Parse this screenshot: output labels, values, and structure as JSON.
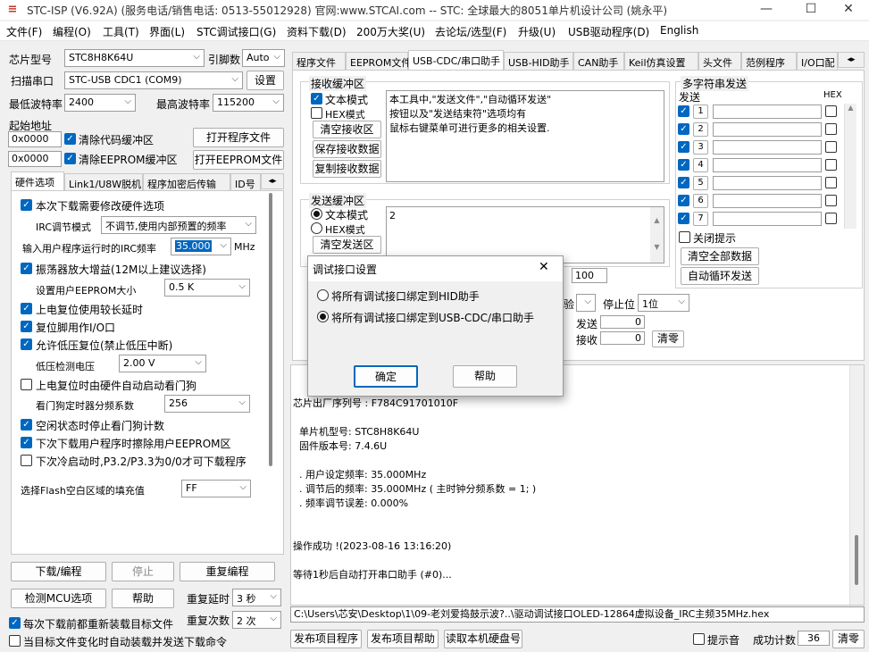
{
  "window": {
    "title": "STC-ISP (V6.92A) (服务电话/销售电话: 0513-55012928) 官网:www.STCAI.com  -- STC: 全球最大的8051单片机设计公司 (姚永平)",
    "min": "—",
    "max": "☐",
    "close": "✕"
  },
  "menu": [
    "文件(F)",
    "编程(O)",
    "工具(T)",
    "界面(L)",
    "STC调试接口(G)",
    "资料下载(D)",
    "200万大奖(U)",
    "去论坛/选型(F)",
    "升级(U)",
    "USB驱动程序(D)",
    "English"
  ],
  "left": {
    "chip_label": "芯片型号",
    "chip_value": "STC8H8K64U",
    "pins_label": "引脚数",
    "pins_value": "Auto",
    "port_btn": "扫描串口",
    "port_value": "STC-USB CDC1 (COM9)",
    "settings_btn": "设置",
    "minbaud_label": "最低波特率",
    "minbaud_value": "2400",
    "maxbaud_label": "最高波特率",
    "maxbaud_value": "115200",
    "start_addr_label": "起始地址",
    "addr1": "0x0000",
    "clear_code_label": "清除代码缓冲区",
    "open_prog_btn": "打开程序文件",
    "addr2": "0x0000",
    "clear_eeprom_label": "清除EEPROM缓冲区",
    "open_eeprom_btn": "打开EEPROM文件",
    "subtabs": [
      "硬件选项",
      "Link1/U8W脱机",
      "程序加密后传输",
      "ID号"
    ],
    "hw": {
      "opt_modify": "本次下载需要修改硬件选项",
      "irc_mode_label": "IRC调节模式",
      "irc_mode_value": "不调节,使用内部预置的频率",
      "irc_freq_label": "输入用户程序运行时的IRC频率",
      "irc_freq_value": "35.000",
      "irc_freq_unit": "MHz",
      "osc_gain": "振荡器放大增益(12M以上建议选择)",
      "eeprom_size_label": "设置用户EEPROM大小",
      "eeprom_size_value": "0.5 K",
      "por_delay": "上电复位使用较长延时",
      "reset_io": "复位脚用作I/O口",
      "lvr": "允许低压复位(禁止低压中断)",
      "lv_label": "低压检测电压",
      "lv_value": "2.00 V",
      "wdt_auto": "上电复位时由硬件自动启动看门狗",
      "wdt_div_label": "看门狗定时器分频系数",
      "wdt_div_value": "256",
      "idle_wdt": "空闲状态时停止看门狗计数",
      "erase_eeprom": "下次下载用户程序时擦除用户EEPROM区",
      "cold_p32": "下次冷启动时,P3.2/P3.3为0/0才可下载程序",
      "flash_fill_label": "选择Flash空白区域的填充值",
      "flash_fill_value": "FF"
    },
    "download_btn": "下载/编程",
    "stop_btn": "停止",
    "reprog_btn": "重复编程",
    "detect_btn": "检测MCU选项",
    "help_btn": "帮助",
    "repeat_delay_label": "重复延时",
    "repeat_delay_value": "3 秒",
    "repeat_count_label": "重复次数",
    "repeat_count_value": "2 次",
    "reload_label": "每次下载前都重新装载目标文件",
    "autosend_label": "当目标文件变化时自动装载并发送下载命令"
  },
  "right": {
    "tabs": [
      "程序文件",
      "EEPROM文件",
      "USB-CDC/串口助手",
      "USB-HID助手",
      "CAN助手",
      "Keil仿真设置",
      "头文件",
      "范例程序",
      "I/O口配"
    ],
    "recv_group": "接收缓冲区",
    "text_mode": "文本模式",
    "hex_mode": "HEX模式",
    "clear_recv_btn": "清空接收区",
    "save_recv_btn": "保存接收数据",
    "copy_recv_btn": "复制接收数据",
    "recv_text": "本工具中,\"发送文件\",\"自动循环发送\"\n按钮以及\"发送结束符\"选项均有\n鼠标右键菜单可进行更多的相关设置.",
    "send_group": "发送缓冲区",
    "send_text_mode": "文本模式",
    "send_hex_mode": "HEX模式",
    "clear_send_btn": "清空发送区",
    "send_text": "2",
    "interval_value": "100",
    "parity_partial": "验",
    "stopbit_label": "停止位",
    "stopbit_value": "1位",
    "send_count_label": "发送",
    "send_count": "0",
    "recv_count_label": "接收",
    "recv_count": "0",
    "clear_count_btn": "清零",
    "multi": {
      "group": "多字符串发送",
      "send_col": "发送",
      "hex_col": "HEX",
      "rows": [
        "1",
        "2",
        "3",
        "4",
        "5",
        "6",
        "7"
      ],
      "close_hint": "关闭提示",
      "clear_all_btn": "清空全部数据",
      "auto_loop_btn": "自动循环发送"
    }
  },
  "log": [
    "芯片出厂序列号 : F784C91701010F",
    "",
    "  单片机型号: STC8H8K64U",
    "  固件版本号: 7.4.6U",
    "",
    "  . 用户设定频率: 35.000MHz",
    "  . 调节后的频率: 35.000MHz ( 主时钟分频系数 = 1; )",
    "  . 频率调节误差: 0.000%",
    "",
    "",
    "操作成功 !(2023-08-16 13:16:20)",
    "",
    "等待1秒后自动打开串口助手 (#0)..."
  ],
  "path": "C:\\Users\\芯安\\Desktop\\1\\09-老刘爱捣鼓示波?..\\驱动调试接口OLED-12864虚拟设备_IRC主频35MHz.hex",
  "bottom": {
    "publish_btn": "发布项目程序",
    "publish_help_btn": "发布项目帮助",
    "read_disk_btn": "读取本机硬盘号",
    "beep_label": "提示音",
    "success_label": "成功计数",
    "success_count": "36",
    "clear_btn": "清零"
  },
  "dialog": {
    "title": "调试接口设置",
    "close": "✕",
    "opt_hid": "将所有调试接口绑定到HID助手",
    "opt_cdc": "将所有调试接口绑定到USB-CDC/串口助手",
    "ok_btn": "确定",
    "help_btn": "帮助"
  }
}
